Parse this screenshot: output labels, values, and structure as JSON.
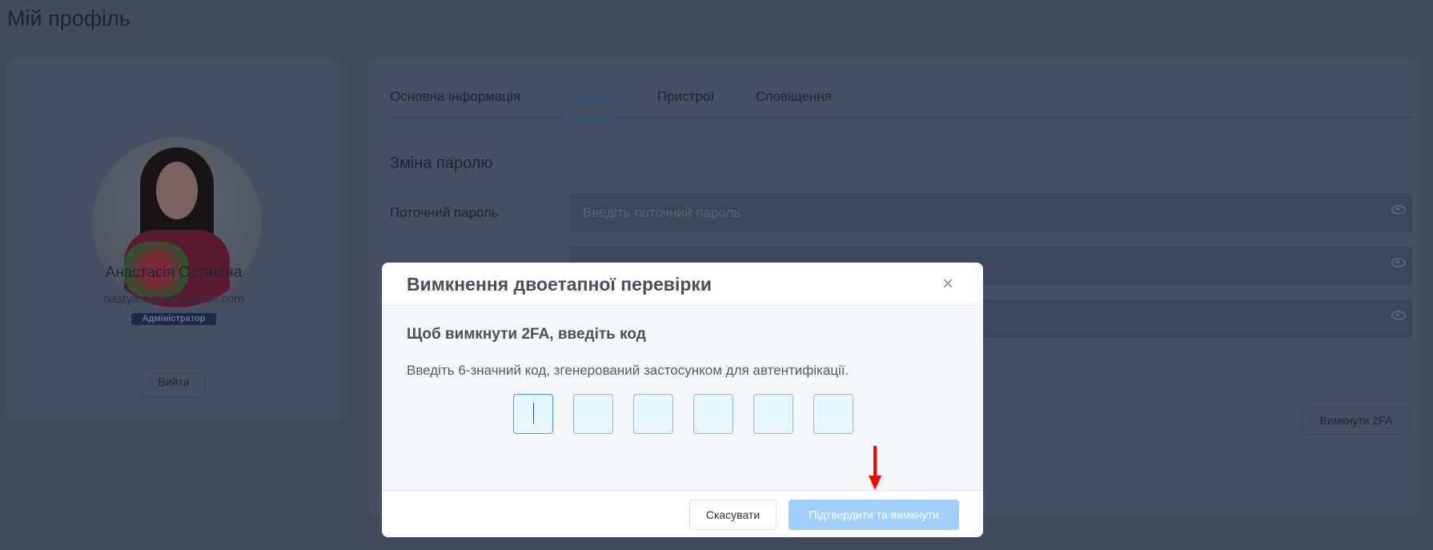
{
  "page": {
    "title": "Мій профіль"
  },
  "profile": {
    "name": "Анастасія Останіна",
    "email": "nastya.skandi@gmail.com",
    "role": "Адміністратор",
    "logout": "Вийти"
  },
  "tabs": [
    {
      "label": "Основна інформація",
      "active": false
    },
    {
      "label": "Безпека",
      "active": true
    },
    {
      "label": "Пристрої",
      "active": false
    },
    {
      "label": "Сповіщення",
      "active": false
    }
  ],
  "security": {
    "section_title": "Зміна паролю",
    "current_label": "Поточний пароль",
    "current_placeholder": "Введіть поточний пароль",
    "disable_2fa": "Вимкнути 2FA"
  },
  "modal": {
    "title": "Вимкнення двоетапної перевірки",
    "subtitle": "Щоб вимкнути 2FA, введіть код",
    "description": "Введіть 6-значний код, згенерований застосунком для автентифікації.",
    "code_digits": [
      "",
      "",
      "",
      "",
      "",
      ""
    ],
    "cancel": "Скасувати",
    "confirm": "Підтвердити та вимкнути",
    "close_icon": "×"
  },
  "colors": {
    "accent": "#409eff",
    "confirm_disabled": "#a0cfff",
    "annotation_arrow": "#ff0000"
  }
}
